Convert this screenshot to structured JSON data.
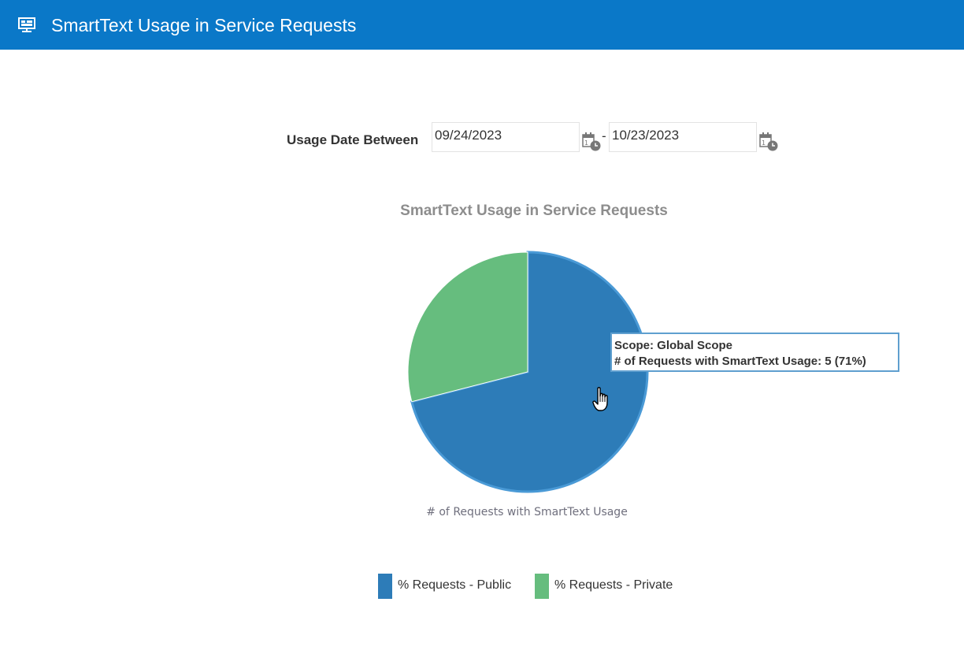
{
  "header": {
    "title": "SmartText Usage in Service Requests",
    "icon": "presentation-screen-icon",
    "background_color": "#0a78c8"
  },
  "filter": {
    "label": "Usage Date Between",
    "from_value": "09/24/2023",
    "separator": "-",
    "to_value": "10/23/2023",
    "calendar_icon": "calendar-clock-icon"
  },
  "chart_data": {
    "type": "pie",
    "title": "SmartText Usage in Service Requests",
    "value_label": "# of Requests with SmartText Usage",
    "slices": [
      {
        "name": "% Requests - Public",
        "percent": 71,
        "color": "#2d7cb8"
      },
      {
        "name": "% Requests - Private",
        "percent": 29,
        "color": "#66bd7e"
      }
    ],
    "legend": [
      "% Requests - Public",
      "% Requests - Private"
    ],
    "legend_position": "bottom"
  },
  "tooltip": {
    "line1": "Scope: Global Scope",
    "line2": "# of Requests with SmartText Usage: 5 (71%)"
  }
}
